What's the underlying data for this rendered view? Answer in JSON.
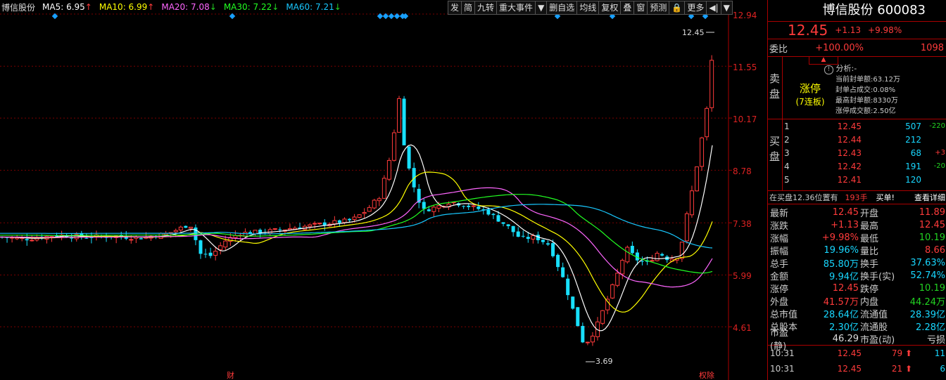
{
  "header": {
    "stock_name": "博信股份",
    "ma5_label": "MA5: 6.95",
    "ma10_label": "MA10: 6.99",
    "ma20_label": "MA20: 7.08",
    "ma30_label": "MA30: 7.22",
    "ma60_label": "MA60: 7.21",
    "colors": {
      "ma5": "#ffffff",
      "ma10": "#ffff00",
      "ma20": "#ff66ff",
      "ma30": "#22ff22",
      "ma60": "#18c8ff"
    }
  },
  "toolbar": {
    "items": [
      "发",
      "简",
      "九转",
      "重大事件",
      "▼",
      "删自选",
      "均线",
      "复权",
      "叠",
      "窗",
      "预测",
      "🔒",
      "更多",
      "◀|",
      "▼"
    ]
  },
  "chart": {
    "y_labels": [
      "12.94",
      "11.55",
      "10.17",
      "8.78",
      "7.38",
      "5.99",
      "4.61"
    ],
    "high_label": "12.45",
    "low_label": "3.69",
    "bottom_left_marker": "财",
    "bottom_right_marker": "权除"
  },
  "chart_data": {
    "type": "candlestick",
    "y_ticks": [
      12.94,
      11.55,
      10.17,
      8.78,
      7.38,
      5.99,
      4.61
    ],
    "annotations": [
      "12.45",
      "3.69"
    ],
    "ma_lines": [
      "MA5",
      "MA10",
      "MA20",
      "MA30",
      "MA60"
    ]
  },
  "panel": {
    "title": "博信股份 600083",
    "price": "12.45",
    "change": "+1.13",
    "change_pct": "+9.98%",
    "weibi_label": "委比",
    "weibi_value": "+100.00%",
    "weibi_num": "1098",
    "sell_label_1": "卖",
    "sell_label_2": "盘",
    "limit_up_title": "涨停",
    "limit_up_sub": "(7连板)",
    "analysis_title": "分析:-",
    "analysis_lines": [
      "当前封单额:63.12万",
      "封单占成交:0.08%",
      "最高封单额:8330万",
      "涨停成交额:2.50亿"
    ],
    "buy_label_1": "买",
    "buy_label_2": "盘",
    "buy_rows": [
      {
        "level": "1",
        "price": "12.45",
        "vol": "507",
        "chg": "-220"
      },
      {
        "level": "2",
        "price": "12.44",
        "vol": "212",
        "chg": ""
      },
      {
        "level": "3",
        "price": "12.43",
        "vol": "68",
        "chg": "+3"
      },
      {
        "level": "4",
        "price": "12.42",
        "vol": "191",
        "chg": "-20"
      },
      {
        "level": "5",
        "price": "12.41",
        "vol": "120",
        "chg": ""
      }
    ],
    "buy_note": "在买盘12.36位置有",
    "buy_note_vol": "193手",
    "buy_note_action": "买单!",
    "detail_link": "查看详细",
    "stats": [
      {
        "k": "最新",
        "v": "12.45",
        "vc": "red",
        "k2": "开盘",
        "v2": "11.89",
        "v2c": "red"
      },
      {
        "k": "涨跌",
        "v": "+1.13",
        "vc": "red",
        "k2": "最高",
        "v2": "12.45",
        "v2c": "red"
      },
      {
        "k": "涨幅",
        "v": "+9.98%",
        "vc": "red",
        "k2": "最低",
        "v2": "10.19",
        "v2c": "green"
      },
      {
        "k": "振幅",
        "v": "19.96%",
        "vc": "cyan",
        "k2": "量比",
        "v2": "8.66",
        "v2c": "red"
      },
      {
        "k": "总手",
        "v": "85.80万",
        "vc": "cyan",
        "k2": "换手",
        "v2": "37.63%",
        "v2c": "cyan"
      },
      {
        "k": "金额",
        "v": "9.94亿",
        "vc": "cyan",
        "k2": "换手(实)",
        "v2": "52.74%",
        "v2c": "cyan"
      },
      {
        "k": "涨停",
        "v": "12.45",
        "vc": "red",
        "k2": "跌停",
        "v2": "10.19",
        "v2c": "green"
      },
      {
        "k": "外盘",
        "v": "41.57万",
        "vc": "red",
        "k2": "内盘",
        "v2": "44.24万",
        "v2c": "green"
      },
      {
        "k": "总市值",
        "v": "28.64亿",
        "vc": "cyan",
        "k2": "流通值",
        "v2": "28.39亿",
        "v2c": "cyan"
      },
      {
        "k": "总股本",
        "v": "2.30亿",
        "vc": "cyan",
        "k2": "流通股",
        "v2": "2.28亿",
        "v2c": "cyan"
      },
      {
        "k": "市盈(静)",
        "v": "46.29",
        "vc": "white",
        "k2": "市盈(动)",
        "v2": "亏损",
        "v2c": "white"
      }
    ],
    "ticks": [
      {
        "time": "10:31",
        "price": "12.45",
        "vol": "79",
        "num": "11"
      },
      {
        "time": "10:31",
        "price": "12.45",
        "vol": "21",
        "num": "6"
      }
    ]
  }
}
